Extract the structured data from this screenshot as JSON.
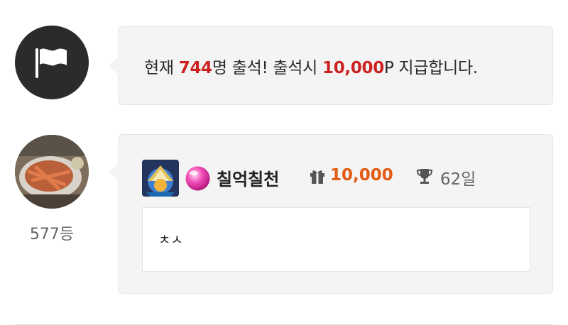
{
  "notice": {
    "prefix": "현재 ",
    "count": "744",
    "middle": "명 출석! 출석시 ",
    "reward": "10,000",
    "suffix": "P 지급합니다."
  },
  "icons": {
    "notice_icon": "flag-icon",
    "points_icon": "gift-icon",
    "days_icon": "trophy-icon"
  },
  "user": {
    "rank": "577등",
    "nickname": "칠억칠천",
    "points": "10,000",
    "days": "62일",
    "comment": "ㅊㅅ"
  },
  "colors": {
    "highlight_red": "#cc2222",
    "points_orange": "#e35b12",
    "bubble_bg": "#f4f4f4",
    "flag_circle": "#2b2b2b"
  }
}
